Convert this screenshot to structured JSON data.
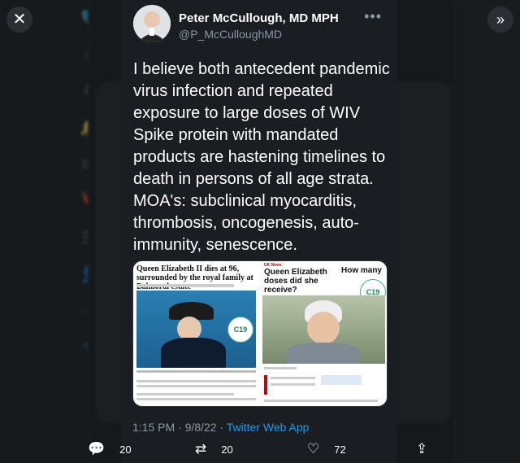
{
  "overlay": {
    "close_icon": "close-icon",
    "expand_icon": "expand-icon"
  },
  "tweet": {
    "author_name": "Peter McCullough, MD MPH",
    "author_handle": "@P_McCulloughMD",
    "text": "I believe both antecedent pandemic virus infection and repeated exposure to large doses of WIV Spike protein with mandated products are hastening timelines to death in persons of all age strata. MOA's:  subclinical myocarditis, thrombosis, oncogenesis, auto-immunity, senescence.",
    "media": {
      "left_title": "Queen Elizabeth II dies at 96, surrounded by the royal family at Balmoral estate",
      "right_tag": "UK News",
      "right_title": "Queen Elizabeth doses did she receive?",
      "right_howmany": "How many",
      "badge": "C19"
    },
    "time": "1:15 PM",
    "date": "9/8/22",
    "separator": " · ",
    "app": "Twitter Web App"
  },
  "actions": {
    "replies": "20",
    "retweets": "20",
    "likes": "72"
  }
}
